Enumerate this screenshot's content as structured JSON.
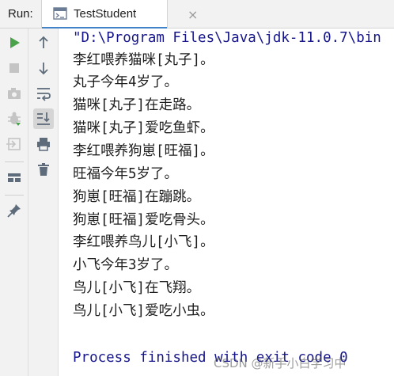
{
  "panel": {
    "label": "Run:"
  },
  "tab": {
    "title": "TestStudent",
    "close": "×"
  },
  "colors": {
    "accent": "#4083c9",
    "run": "#4aa24a",
    "command": "#16168a"
  },
  "toolbar_left": [
    {
      "name": "rerun-icon"
    },
    {
      "name": "stop-icon"
    },
    {
      "name": "camera-icon"
    },
    {
      "name": "debug-bug-icon"
    },
    {
      "name": "exit-icon"
    },
    {
      "name": "layout-icon"
    },
    {
      "name": "pin-icon"
    }
  ],
  "toolbar_right": [
    {
      "name": "arrow-up-icon"
    },
    {
      "name": "arrow-down-icon"
    },
    {
      "name": "soft-wrap-icon"
    },
    {
      "name": "scroll-to-end-icon"
    },
    {
      "name": "print-icon"
    },
    {
      "name": "trash-icon"
    }
  ],
  "console": {
    "command": "\"D:\\Program Files\\Java\\jdk-11.0.7\\bin",
    "lines": [
      "李红喂养猫咪[丸子]。",
      "丸子今年4岁了。",
      "猫咪[丸子]在走路。",
      "猫咪[丸子]爱吃鱼虾。",
      "李红喂养狗崽[旺福]。",
      "旺福今年5岁了。",
      "狗崽[旺福]在蹦跳。",
      "狗崽[旺福]爱吃骨头。",
      "李红喂养鸟儿[小飞]。",
      "小飞今年3岁了。",
      "鸟儿[小飞]在飞翔。",
      "鸟儿[小飞]爱吃小虫。"
    ],
    "process": "Process finished with exit code 0"
  },
  "watermark": "CSDN @新手小白学习中"
}
